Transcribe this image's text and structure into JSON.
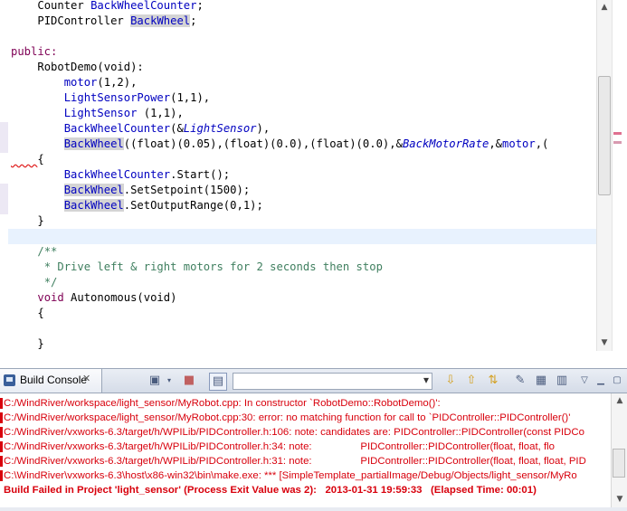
{
  "editor": {
    "lines": {
      "l1": [
        "Counter ",
        "BackWheelCounter",
        ";"
      ],
      "l2": [
        "PIDController ",
        "BackWheel",
        ";"
      ],
      "l4": "public:",
      "l5": [
        "RobotDemo",
        "(void):"
      ],
      "l6": [
        "motor",
        "(1,2),"
      ],
      "l7": [
        "LightSensorPower",
        "(1,1),"
      ],
      "l8": [
        "LightSensor",
        " (1,1),"
      ],
      "l9": [
        "BackWheelCounter",
        "(&",
        "LightSensor",
        "),"
      ],
      "l10": [
        "BackWheel",
        "((float)(0.05),(float)(0.0),(float)(0.0),&",
        "BackMotorRate",
        ",&",
        "motor",
        ",("
      ],
      "l11": "{",
      "l12": [
        "BackWheelCounter",
        ".Start();"
      ],
      "l13": [
        "BackWheel",
        ".SetSetpoint(1500);"
      ],
      "l14": [
        "BackWheel",
        ".SetOutputRange(0,1);"
      ],
      "l15": "}",
      "l17": "/**",
      "l18": " * Drive left & right motors for 2 seconds then stop",
      "l19": " */",
      "l20": [
        "void ",
        "Autonomous",
        "(void)"
      ],
      "l21": "{",
      "l23": "}"
    }
  },
  "console": {
    "tab_label": "Build Console",
    "lines": [
      "C:/WindRiver/workspace/light_sensor/MyRobot.cpp: In constructor `RobotDemo::RobotDemo()':",
      "C:/WindRiver/workspace/light_sensor/MyRobot.cpp:30: error: no matching function for call to `PIDController::PIDController()'",
      "C:/WindRiver/vxworks-6.3/target/h/WPILib/PIDController.h:106: note: candidates are: PIDController::PIDController(const PIDCo",
      "C:/WindRiver/vxworks-6.3/target/h/WPILib/PIDController.h:34: note:                 PIDController::PIDController(float, float, flo",
      "C:/WindRiver/vxworks-6.3/target/h/WPILib/PIDController.h:31: note:                 PIDController::PIDController(float, float, float, PID",
      "C:\\WindRiver\\vxworks-6.3\\host\\x86-win32\\bin\\make.exe: *** [SimpleTemplate_partialImage/Debug/Objects/light_sensor/MyRo",
      "Build Failed in Project 'light_sensor' (Process Exit Value was 2):   2013-01-31 19:59:33   (Elapsed Time: 00:01)"
    ]
  },
  "colors": {
    "error_text": "#d8000c",
    "keyword": "#7f0055",
    "field": "#0000c0",
    "comment": "#3f7f5f",
    "current_line": "#e8f2fe"
  },
  "icons": [
    "console-tab-icon",
    "close-tab-icon",
    "pin-console-icon",
    "terminate-icon",
    "display-console-icon",
    "previous-error-icon",
    "next-error-icon",
    "word-wrap-icon",
    "clear-console-icon",
    "scroll-lock-icon",
    "view-menu-icon",
    "minimize-icon",
    "maximize-icon"
  ]
}
